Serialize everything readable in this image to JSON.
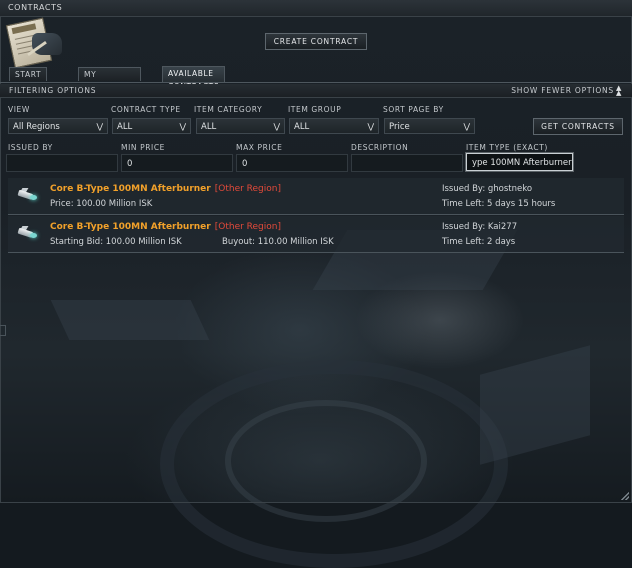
{
  "window": {
    "title": "CONTRACTS"
  },
  "toolbar": {
    "create_contract": "CREATE CONTRACT"
  },
  "tabs": [
    {
      "label": "START PAGE"
    },
    {
      "label": "MY CONTRACTS"
    },
    {
      "label": "AVAILABLE CONTRACTS"
    }
  ],
  "filter_bar": {
    "label": "FILTERING OPTIONS",
    "show_fewer": "SHOW FEWER OPTIONS"
  },
  "filters": {
    "view": {
      "label": "VIEW",
      "value": "All Regions"
    },
    "contract_type": {
      "label": "CONTRACT TYPE",
      "value": "ALL"
    },
    "item_category": {
      "label": "ITEM CATEGORY",
      "value": "ALL"
    },
    "item_group": {
      "label": "ITEM GROUP",
      "value": "ALL"
    },
    "sort_page_by": {
      "label": "SORT PAGE BY",
      "value": "Price"
    },
    "get_contracts": "GET CONTRACTS",
    "issued_by": {
      "label": "ISSUED BY",
      "value": ""
    },
    "min_price": {
      "label": "MIN PRICE",
      "value": "0"
    },
    "max_price": {
      "label": "MAX PRICE",
      "value": "0"
    },
    "description": {
      "label": "DESCRIPTION",
      "value": ""
    },
    "item_type": {
      "label": "ITEM TYPE (EXACT)",
      "value": "ype 100MN Afterburner"
    }
  },
  "results": [
    {
      "name": "Core B-Type 100MN Afterburner",
      "region": "[Other Region]",
      "info1": "Price: 100.00 Million ISK",
      "info2": "",
      "issued_by": "Issued By: ghostneko",
      "time_left": "Time Left: 5 days 15 hours"
    },
    {
      "name": "Core B-Type 100MN Afterburner",
      "region": "[Other Region]",
      "info1": "Starting Bid: 100.00 Million ISK",
      "info2": "Buyout: 110.00 Million ISK",
      "issued_by": "Issued By: Kai277",
      "time_left": "Time Left: 2 days"
    }
  ],
  "icons": {
    "window": "contracts-document-icon",
    "collapse": "double-chevron-up-icon",
    "dropdown": "chevron-down-icon",
    "item": "afterburner-module-icon"
  },
  "colors": {
    "item_name": "#f2a12a",
    "region": "#e24a3a",
    "background": "#141a1f"
  }
}
